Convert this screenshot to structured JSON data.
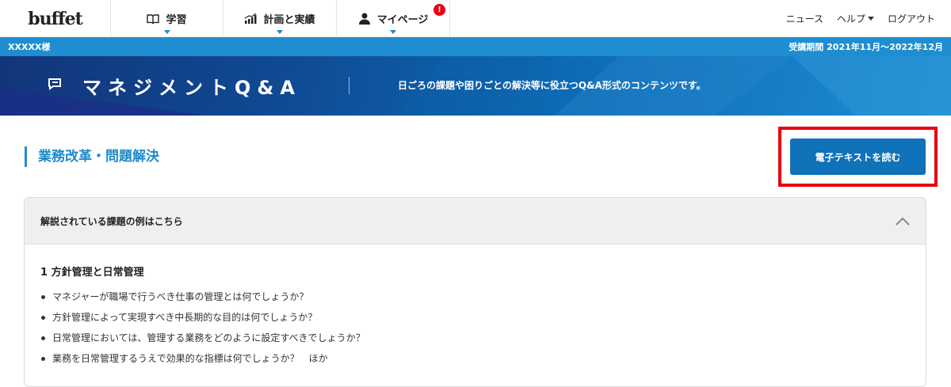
{
  "nav": {
    "logo": "buffet",
    "tabs": [
      {
        "label": "学習",
        "icon": "book-icon"
      },
      {
        "label": "計画と実績",
        "icon": "bar-chart-icon"
      },
      {
        "label": "マイページ",
        "icon": "person-icon",
        "badge": "!"
      }
    ],
    "links": {
      "news": "ニュース",
      "help": "ヘルプ",
      "logout": "ログアウト"
    }
  },
  "userbar": {
    "user": "XXXXX様",
    "period": "受講期間 2021年11月～2022年12月"
  },
  "hero": {
    "title": "マネジメントQ&A",
    "description": "日ごろの課題や困りごとの解決等に役立つQ&A形式のコンテンツです。"
  },
  "section": {
    "title": "業務改革・問題解決",
    "read_button": "電子テキストを読む"
  },
  "accordion": {
    "header": "解説されている課題の例はこちら",
    "topic": "1 方針管理と日常管理",
    "items": [
      "マネジャーが職場で行うべき仕事の管理とは何でしょうか？",
      "方針管理によって実現すべき中長期的な目的は何でしょうか？",
      "日常管理においては、管理する業務をどのように設定すべきでしょうか？",
      "業務を日常管理するうえで効果的な指標は何でしょうか？　ほか"
    ]
  },
  "colors": {
    "accent": "#1f8ed0",
    "button": "#1072b8",
    "highlight": "#e60012"
  }
}
